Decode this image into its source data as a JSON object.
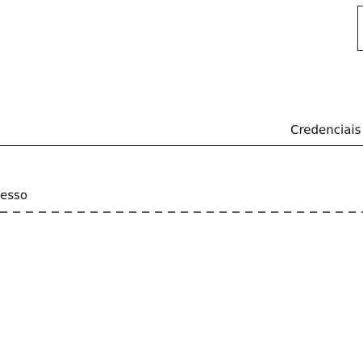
{
  "diagram": {
    "labels": {
      "upper_message": "Credenciais d",
      "lower_message": "esso"
    },
    "lines": {
      "upper": "solid",
      "lower": "dashed"
    },
    "colors": {
      "stroke": "#222222",
      "text": "#111111",
      "background": "#ffffff"
    }
  }
}
